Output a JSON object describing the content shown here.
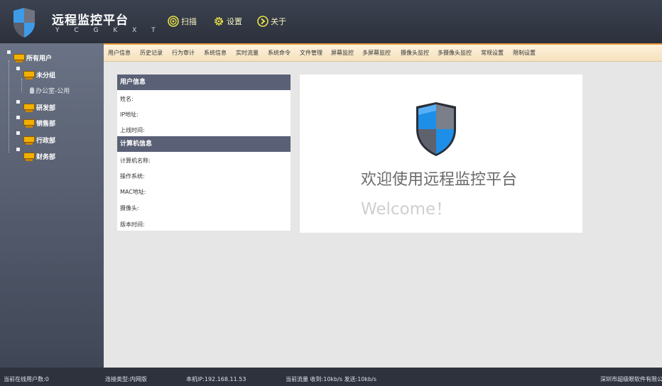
{
  "header": {
    "title": "远程监控平台",
    "subtitle": "Y C G K X T",
    "buttons": [
      {
        "label": "扫描",
        "icon": "scan-icon"
      },
      {
        "label": "设置",
        "icon": "gear-icon"
      },
      {
        "label": "关于",
        "icon": "arrow-right-circle-icon"
      }
    ]
  },
  "sidebar": {
    "root": "所有用户",
    "groups": [
      "未分组",
      "研发部",
      "销售部",
      "行政部",
      "财务部"
    ],
    "users": [
      "办公室-公用"
    ]
  },
  "menu": {
    "items": [
      "用户信息",
      "历史记录",
      "行为审计",
      "系统信息",
      "实时流量",
      "系统命令",
      "文件管理",
      "屏幕监控",
      "多屏幕监控",
      "摄像头监控",
      "多摄像头监控",
      "常规设置",
      "限制设置"
    ]
  },
  "panel": {
    "user_info": {
      "title": "用户信息",
      "fields": [
        "姓名:",
        "IP地址:",
        "上线时间:"
      ]
    },
    "computer_info": {
      "title": "计算机信息",
      "fields": [
        "计算机名称:",
        "操作系统:",
        "MAC地址:",
        "摄像头:",
        "版本时间:"
      ]
    }
  },
  "welcome": {
    "text": "欢迎使用远程监控平台",
    "english": "Welcome！"
  },
  "status": {
    "online": "当前在线用户数:0",
    "conn_type": "连接类型:内网版",
    "local_ip": "本机IP:192.168.11.53",
    "traffic": "当前流量 收到:10kb/s   发送:10kb/s",
    "company": "深圳市超级眼软件有限公司"
  },
  "colors": {
    "header_bg": "#2f3440",
    "accent_orange": "#e89a3a",
    "section_header": "#5a6075",
    "menubar_bg": "#f8e8c8",
    "button_text": "#f4f1c0"
  }
}
